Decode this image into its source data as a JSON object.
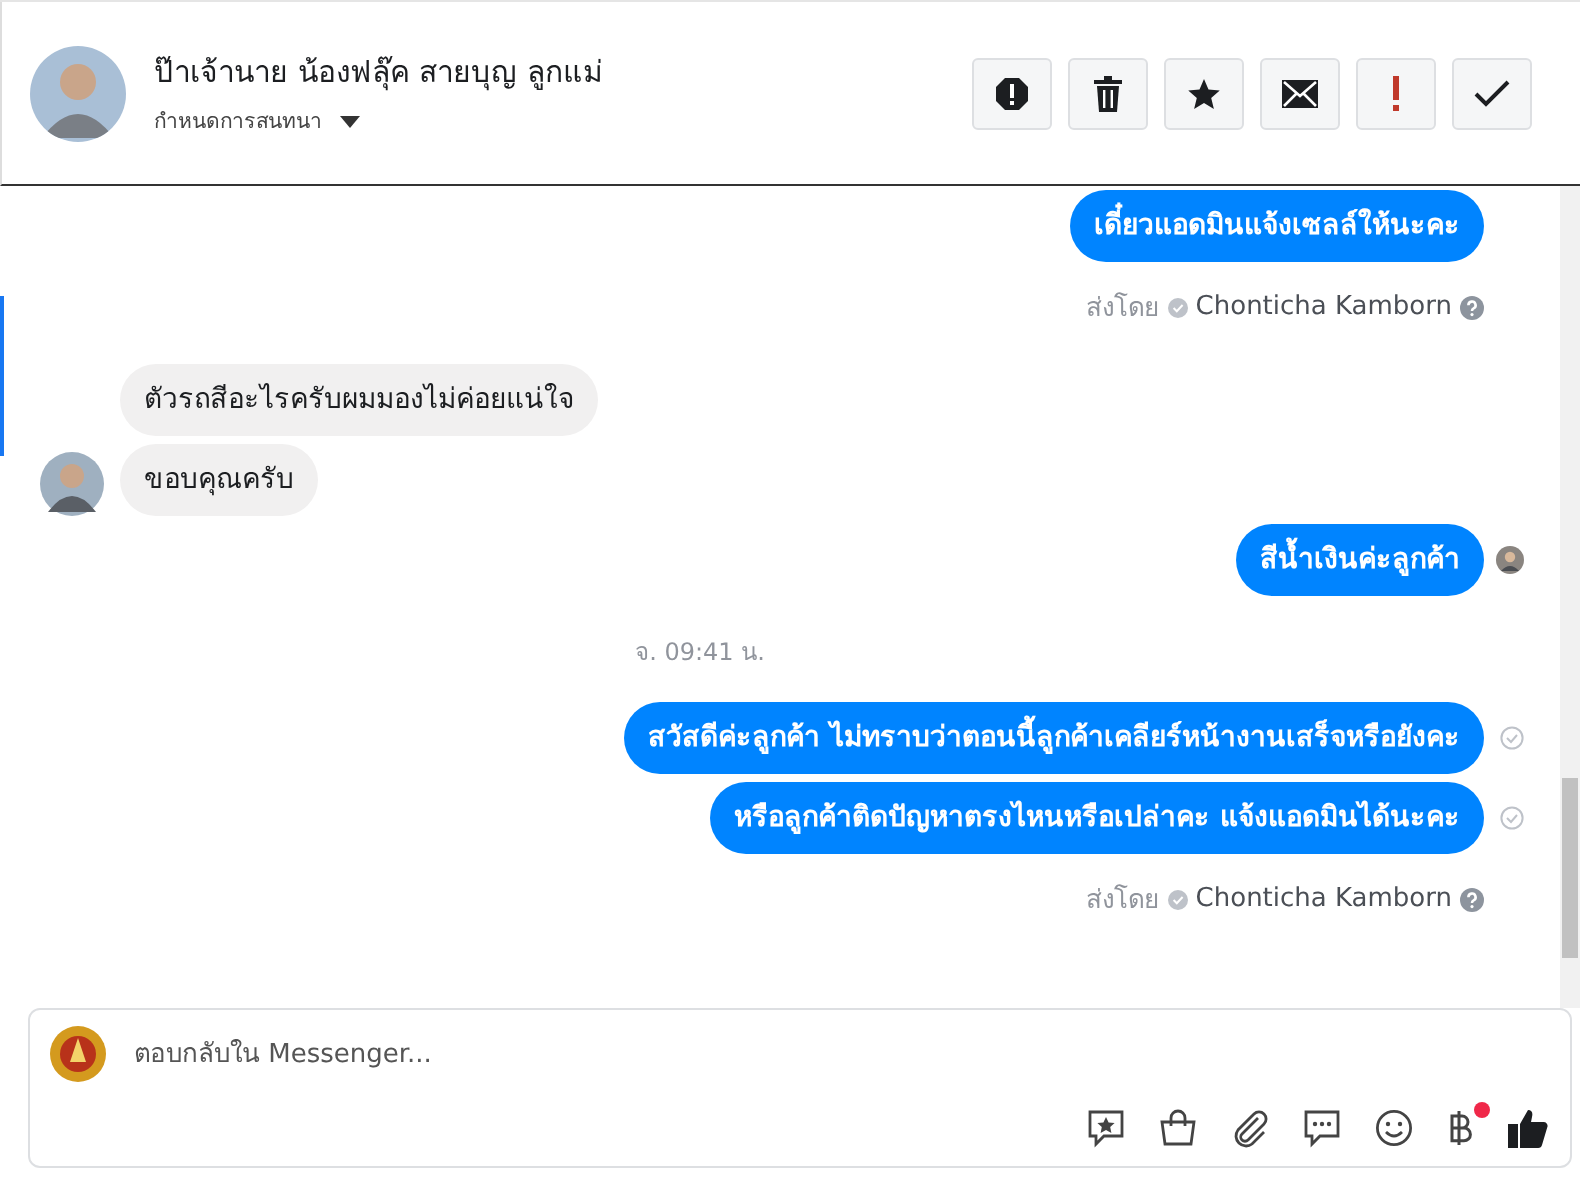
{
  "header": {
    "name": "ป๊าเจ้านาย น้องฟลุ๊ค สายบุญ ลูกแม่",
    "subtitle": "กำหนดการสนทนา",
    "actions": [
      {
        "kind": "report"
      },
      {
        "kind": "delete"
      },
      {
        "kind": "star"
      },
      {
        "kind": "mail"
      },
      {
        "kind": "important"
      },
      {
        "kind": "done"
      }
    ]
  },
  "messages": [
    {
      "kind": "clipped"
    },
    {
      "kind": "sent",
      "text": "เดี๋ยวแอดมินแจ้งเซลล์ให้นะคะ",
      "seen": false,
      "delivered": false
    },
    {
      "kind": "sent_by",
      "label": "ส่งโดย",
      "name": "Chonticha Kamborn"
    },
    {
      "kind": "received",
      "text": "ตัวรถสีอะไรครับผมมองไม่ค่อยแน่ใจ",
      "avatar": false
    },
    {
      "kind": "received",
      "text": "ขอบคุณครับ",
      "avatar": true
    },
    {
      "kind": "sent",
      "text": "สีน้ำเงินค่ะลูกค้า",
      "seen": true
    },
    {
      "kind": "time",
      "text": "จ. 09:41 น."
    },
    {
      "kind": "sent",
      "text": "สวัสดีค่ะลูกค้า ไม่ทราบว่าตอนนี้ลูกค้าเคลียร์หน้างานเสร็จหรือยังคะ",
      "seen": false,
      "delivered": true
    },
    {
      "kind": "sent",
      "text": "หรือลูกค้าติดปัญหาตรงไหนหรือเปล่าคะ แจ้งแอดมินได้นะคะ",
      "seen": false,
      "delivered": true
    },
    {
      "kind": "sent_by",
      "label": "ส่งโดย",
      "name": "Chonticha Kamborn"
    }
  ],
  "composer": {
    "placeholder": "ตอบกลับใน Messenger...",
    "payment_notification": true
  }
}
